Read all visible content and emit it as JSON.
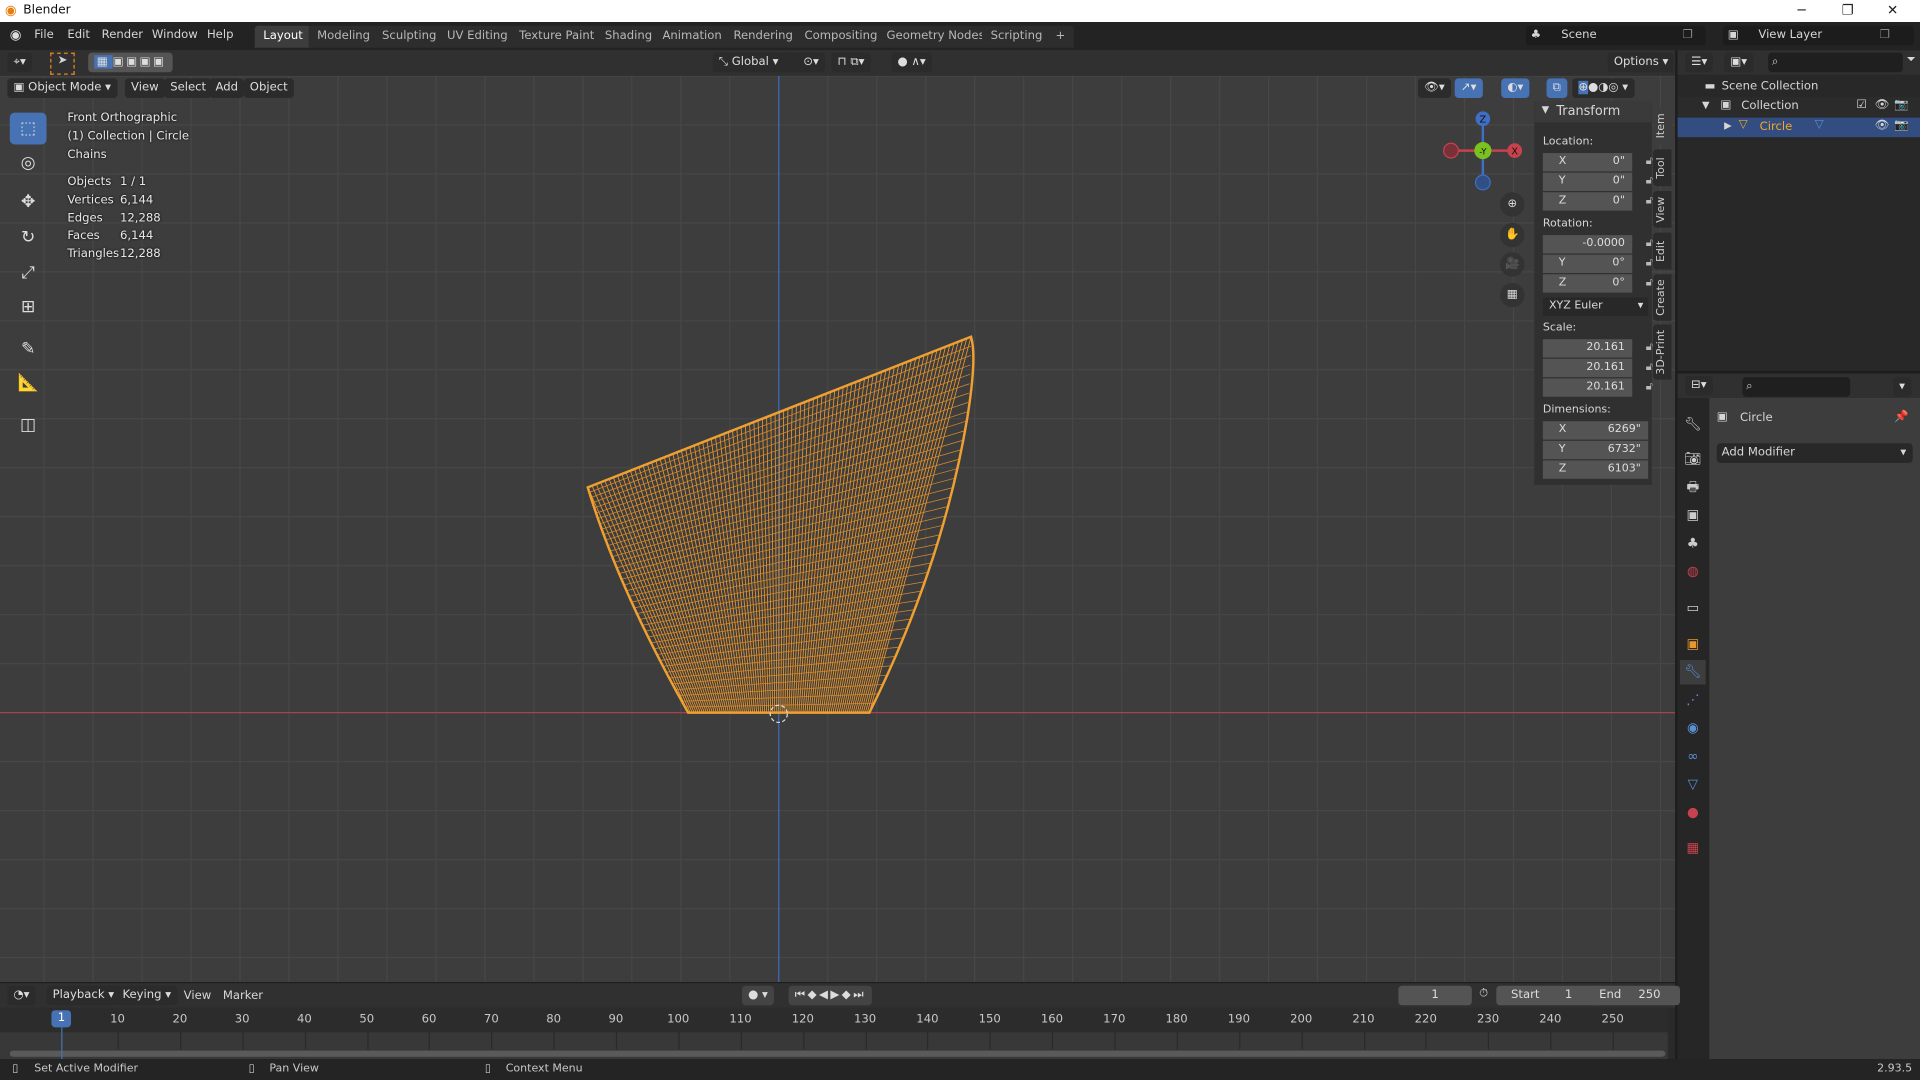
{
  "window": {
    "title": "Blender",
    "minimize": "─",
    "maximize": "❐",
    "close": "✕"
  },
  "menu": [
    "File",
    "Edit",
    "Render",
    "Window",
    "Help"
  ],
  "workspaces": [
    "Layout",
    "Modeling",
    "Sculpting",
    "UV Editing",
    "Texture Paint",
    "Shading",
    "Animation",
    "Rendering",
    "Compositing",
    "Geometry Nodes",
    "Scripting",
    "+"
  ],
  "active_workspace": "Layout",
  "scene": {
    "label": "Scene",
    "view_layer": "View Layer"
  },
  "viewport_header": {
    "transform_orientation": "Global",
    "options": "Options",
    "mode": "Object Mode",
    "menus": [
      "View",
      "Select",
      "Add",
      "Object"
    ]
  },
  "overlay_info": {
    "view": "Front Orthographic",
    "collection": "(1) Collection | Circle",
    "name": "Chains",
    "stats": [
      {
        "label": "Objects",
        "value": "1 / 1"
      },
      {
        "label": "Vertices",
        "value": "6,144"
      },
      {
        "label": "Edges",
        "value": "12,288"
      },
      {
        "label": "Faces",
        "value": "6,144"
      },
      {
        "label": "Triangles",
        "value": "12,288"
      }
    ]
  },
  "tools": [
    "select-box",
    "cursor",
    "move",
    "rotate",
    "scale",
    "transform",
    "annotate",
    "measure",
    "add-cube"
  ],
  "gizmo": {
    "z": "Z",
    "y": "-Y",
    "x": "X"
  },
  "npanel": {
    "title": "Transform",
    "location_label": "Location:",
    "location": [
      {
        "axis": "X",
        "value": "0\""
      },
      {
        "axis": "Y",
        "value": "0\""
      },
      {
        "axis": "Z",
        "value": "0\""
      }
    ],
    "rotation_label": "Rotation:",
    "rotation": [
      {
        "axis": "",
        "value": "-0.0000"
      },
      {
        "axis": "Y",
        "value": "0°"
      },
      {
        "axis": "Z",
        "value": "0°"
      }
    ],
    "rotation_mode": "XYZ Euler",
    "scale_label": "Scale:",
    "scale": [
      "20.161",
      "20.161",
      "20.161"
    ],
    "dimensions_label": "Dimensions:",
    "dimensions": [
      {
        "axis": "X",
        "value": "6269\""
      },
      {
        "axis": "Y",
        "value": "6732\""
      },
      {
        "axis": "Z",
        "value": "6103\""
      }
    ],
    "tabs": [
      "Item",
      "Tool",
      "View",
      "Edit",
      "Create",
      "3D-Print"
    ]
  },
  "outliner": {
    "root": "Scene Collection",
    "collection": "Collection",
    "object": "Circle"
  },
  "properties": {
    "object": "Circle",
    "add_modifier": "Add Modifier"
  },
  "timeline": {
    "menus": [
      "Playback",
      "Keying",
      "View",
      "Marker"
    ],
    "current_frame": "1",
    "start_label": "Start",
    "start": "1",
    "end_label": "End",
    "end": "250",
    "ticks": [
      "10",
      "20",
      "30",
      "40",
      "50",
      "60",
      "70",
      "80",
      "90",
      "100",
      "110",
      "120",
      "130",
      "140",
      "150",
      "160",
      "170",
      "180",
      "190",
      "200",
      "210",
      "220",
      "230",
      "240",
      "250"
    ],
    "playhead": "1"
  },
  "status": {
    "left": "Set Active Modifier",
    "middle": "Pan View",
    "right": "Context Menu",
    "version": "2.93.5"
  },
  "colors": {
    "accent": "#4772b3",
    "selected": "#f5a623",
    "mesh": "#e8962e",
    "x_axis": "#c8424e",
    "z_axis": "#3f6ec4",
    "y_axis": "#79c21f"
  }
}
